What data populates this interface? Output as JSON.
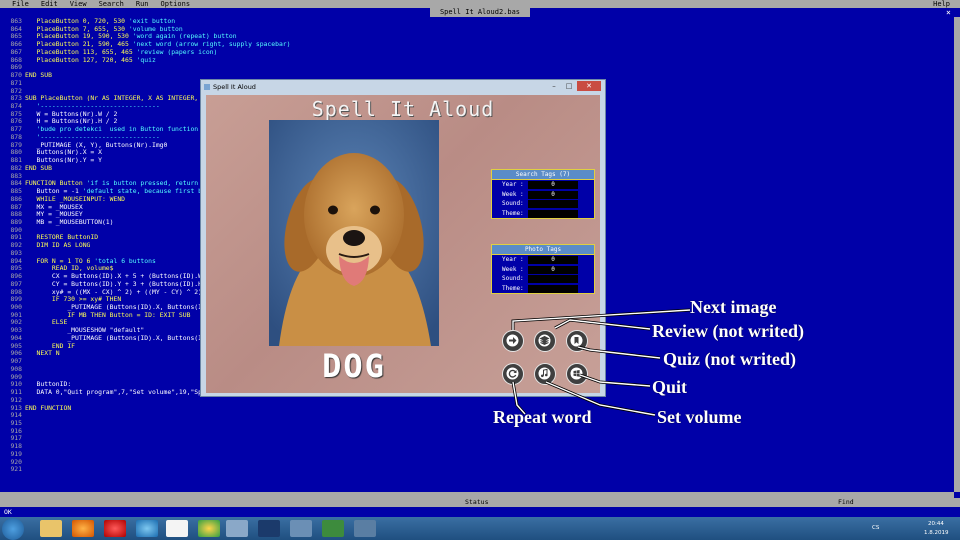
{
  "ide": {
    "title": "Spell It Aloud2.bas",
    "menu": [
      "File",
      "Edit",
      "View",
      "Search",
      "Run",
      "Options"
    ],
    "help": "Help",
    "close": "×",
    "status": "Status",
    "find": "Find",
    "status_left": "OK",
    "lines": [
      {
        "n": "863",
        "segs": [
          {
            "t": "   PlaceButton 0, 720, 530 ",
            "c": "kw"
          },
          {
            "t": "'exit button",
            "c": "cm"
          }
        ]
      },
      {
        "n": "864",
        "segs": [
          {
            "t": "   PlaceButton 7, 655, 530 ",
            "c": "kw"
          },
          {
            "t": "'volume button",
            "c": "cm"
          }
        ]
      },
      {
        "n": "865",
        "segs": [
          {
            "t": "   PlaceButton 19, 590, 530 ",
            "c": "kw"
          },
          {
            "t": "'word again (repeat) button",
            "c": "cm"
          }
        ]
      },
      {
        "n": "866",
        "segs": [
          {
            "t": "   PlaceButton 21, 590, 465 ",
            "c": "kw"
          },
          {
            "t": "'next word (arrow right, supply spacebar)",
            "c": "cm"
          }
        ]
      },
      {
        "n": "867",
        "segs": [
          {
            "t": "   PlaceButton 113, 655, 465 ",
            "c": "kw"
          },
          {
            "t": "'review (papers icon)",
            "c": "cm"
          }
        ]
      },
      {
        "n": "868",
        "segs": [
          {
            "t": "   PlaceButton 127, 720, 465 ",
            "c": "kw"
          },
          {
            "t": "'quiz",
            "c": "cm"
          }
        ]
      },
      {
        "n": "869",
        "segs": []
      },
      {
        "n": "870",
        "segs": [
          {
            "t": "END SUB",
            "c": "kw"
          }
        ]
      },
      {
        "n": "871",
        "segs": []
      },
      {
        "n": "872",
        "segs": []
      },
      {
        "n": "873",
        "segs": [
          {
            "t": "SUB PlaceButton (Nr AS INTEGER, X AS INTEGER, Y AS INTEGER)",
            "c": "kw"
          }
        ]
      },
      {
        "n": "874",
        "segs": [
          {
            "t": "   '-------------------------------",
            "c": "cm"
          }
        ]
      },
      {
        "n": "875",
        "segs": [
          {
            "t": "   W = Buttons(Nr).W / 2",
            "c": ""
          }
        ]
      },
      {
        "n": "876",
        "segs": [
          {
            "t": "   H = Buttons(Nr).H / 2",
            "c": ""
          }
        ]
      },
      {
        "n": "877",
        "segs": [
          {
            "t": "   'bude pro detekci  used in Button function",
            "c": "cm"
          }
        ]
      },
      {
        "n": "878",
        "segs": [
          {
            "t": "   '-------------------------------",
            "c": "cm"
          }
        ]
      },
      {
        "n": "879",
        "segs": [
          {
            "t": "   _PUTIMAGE (X, Y), Buttons(Nr).Img0",
            "c": ""
          }
        ]
      },
      {
        "n": "880",
        "segs": [
          {
            "t": "   Buttons(Nr).X = X",
            "c": ""
          }
        ]
      },
      {
        "n": "881",
        "segs": [
          {
            "t": "   Buttons(Nr).Y = Y",
            "c": ""
          }
        ]
      },
      {
        "n": "882",
        "segs": [
          {
            "t": "END SUB",
            "c": "kw"
          }
        ]
      },
      {
        "n": "883",
        "segs": []
      },
      {
        "n": "884",
        "segs": [
          {
            "t": "FUNCTION Button ",
            "c": "kw"
          },
          {
            "t": "'if is button pressed, return button ID",
            "c": "cm"
          }
        ]
      },
      {
        "n": "885",
        "segs": [
          {
            "t": "   Button = -1 ",
            "c": ""
          },
          {
            "t": "'default state, because first button has ID 0",
            "c": "cm"
          }
        ]
      },
      {
        "n": "886",
        "segs": [
          {
            "t": "   WHILE _MOUSEINPUT: WEND",
            "c": "kw"
          }
        ]
      },
      {
        "n": "887",
        "segs": [
          {
            "t": "   MX = _MOUSEX",
            "c": ""
          }
        ]
      },
      {
        "n": "888",
        "segs": [
          {
            "t": "   MY = _MOUSEY",
            "c": ""
          }
        ]
      },
      {
        "n": "889",
        "segs": [
          {
            "t": "   MB = _MOUSEBUTTON(1)",
            "c": ""
          }
        ]
      },
      {
        "n": "890",
        "segs": []
      },
      {
        "n": "891",
        "segs": [
          {
            "t": "   RESTORE ButtonID",
            "c": "kw"
          }
        ]
      },
      {
        "n": "892",
        "segs": [
          {
            "t": "   DIM ID AS LONG",
            "c": "kw"
          }
        ]
      },
      {
        "n": "893",
        "segs": []
      },
      {
        "n": "894",
        "segs": [
          {
            "t": "   FOR N = 1 TO 6 ",
            "c": "kw"
          },
          {
            "t": "'total 6 buttons",
            "c": "cm"
          }
        ]
      },
      {
        "n": "895",
        "segs": [
          {
            "t": "       READ ID, volume$",
            "c": "kw"
          }
        ]
      },
      {
        "n": "896",
        "segs": [
          {
            "t": "       CX = Buttons(ID).X + 5 + (Buttons(ID).W / 2)",
            "c": ""
          }
        ]
      },
      {
        "n": "897",
        "segs": [
          {
            "t": "       CY = Buttons(ID).Y + 3 + (Buttons(ID).H / 2)",
            "c": ""
          }
        ]
      },
      {
        "n": "898",
        "segs": [
          {
            "t": "       xy# = ((MX - CX) ^ 2) + ((MY - CY) ^ 2)",
            "c": ""
          }
        ]
      },
      {
        "n": "899",
        "segs": [
          {
            "t": "       IF 730 >= xy# THEN",
            "c": "kw"
          }
        ]
      },
      {
        "n": "900",
        "segs": [
          {
            "t": "           _PUTIMAGE (Buttons(ID).X, Buttons(ID).Y), Buttons(ID).Img1",
            "c": ""
          }
        ]
      },
      {
        "n": "901",
        "segs": [
          {
            "t": "           IF MB THEN Button = ID: EXIT SUB",
            "c": "kw"
          }
        ]
      },
      {
        "n": "902",
        "segs": [
          {
            "t": "       ELSE",
            "c": "kw"
          }
        ]
      },
      {
        "n": "903",
        "segs": [
          {
            "t": "           _MOUSESHOW \"default\"",
            "c": ""
          }
        ]
      },
      {
        "n": "904",
        "segs": [
          {
            "t": "           _PUTIMAGE (Buttons(ID).X, Buttons(ID).Y), Buttons(ID).Img0",
            "c": ""
          }
        ]
      },
      {
        "n": "905",
        "segs": [
          {
            "t": "       END IF",
            "c": "kw"
          }
        ]
      },
      {
        "n": "906",
        "segs": [
          {
            "t": "   NEXT N",
            "c": "kw"
          }
        ]
      },
      {
        "n": "907",
        "segs": []
      },
      {
        "n": "908",
        "segs": []
      },
      {
        "n": "909",
        "segs": []
      },
      {
        "n": "910",
        "segs": [
          {
            "t": "   ButtonID:",
            "c": ""
          }
        ]
      },
      {
        "n": "911",
        "segs": [
          {
            "t": "   DATA 0,\"Quit program\",7,\"Set volume\",19,\"Spell word again\",21,\"Next word\",113,\"Review\",127,\"Quiz\"",
            "c": ""
          }
        ]
      },
      {
        "n": "912",
        "segs": []
      },
      {
        "n": "913",
        "segs": [
          {
            "t": "END FUNCTION",
            "c": "kw"
          }
        ]
      },
      {
        "n": "914",
        "segs": []
      },
      {
        "n": "915",
        "segs": []
      },
      {
        "n": "916",
        "segs": []
      },
      {
        "n": "917",
        "segs": []
      },
      {
        "n": "918",
        "segs": []
      },
      {
        "n": "919",
        "segs": []
      },
      {
        "n": "920",
        "segs": []
      },
      {
        "n": "921",
        "segs": []
      }
    ]
  },
  "app": {
    "window_title": "Spell It Aloud",
    "heading": "Spell It Aloud",
    "word": "DOG",
    "search_tags": {
      "title": "Search Tags (7)",
      "rows": [
        {
          "label": "Year :",
          "value": "0"
        },
        {
          "label": "Week :",
          "value": "0"
        },
        {
          "label": "Sound:",
          "value": ""
        },
        {
          "label": "Theme:",
          "value": ""
        }
      ]
    },
    "photo_tags": {
      "title": "Photo Tags",
      "rows": [
        {
          "label": "Year :",
          "value": "0"
        },
        {
          "label": "Week :",
          "value": "0"
        },
        {
          "label": "Sound:",
          "value": ""
        },
        {
          "label": "Theme:",
          "value": ""
        }
      ]
    }
  },
  "annotations": {
    "next_image": "Next image",
    "review": "Review (not writed)",
    "quiz": "Quiz (not writed)",
    "quit": "Quit",
    "repeat": "Repeat word",
    "volume": "Set volume"
  },
  "tray": {
    "lang": "CS",
    "time": "20:44",
    "date": "1.8.2019"
  }
}
